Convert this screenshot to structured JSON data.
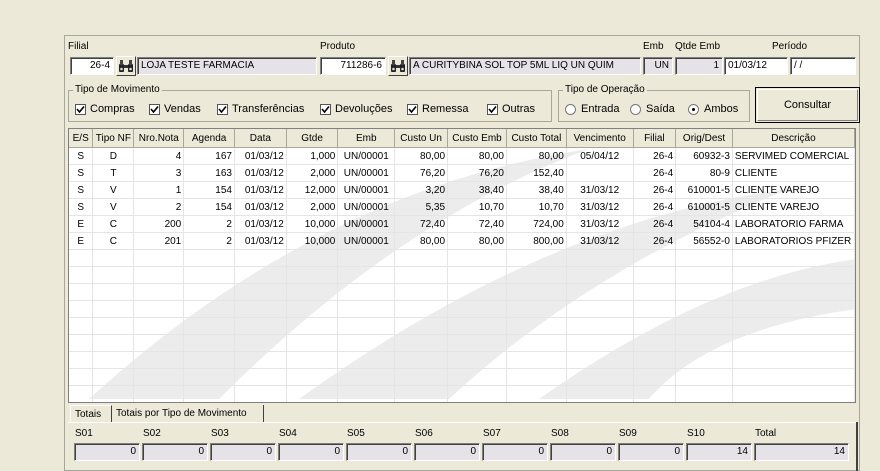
{
  "header": {
    "filial_label": "Filial",
    "filial_code": "26-4",
    "filial_name": "LOJA TESTE FARMACIA",
    "produto_label": "Produto",
    "produto_code": "711286-6",
    "produto_desc": "A CURITYBINA SOL TOP 5ML LIQ UN QUIM",
    "emb_label": "Emb",
    "emb_value": "UN",
    "qtde_emb_label": "Qtde Emb",
    "qtde_emb_value": "1",
    "periodo_label": "Período",
    "periodo_from": "01/03/12",
    "periodo_to": " / /"
  },
  "tipo_movimento": {
    "title": "Tipo de Movimento",
    "items": [
      {
        "label": "Compras",
        "checked": true
      },
      {
        "label": "Vendas",
        "checked": true
      },
      {
        "label": "Transferências",
        "checked": true
      },
      {
        "label": "Devoluções",
        "checked": true
      },
      {
        "label": "Remessa",
        "checked": true
      },
      {
        "label": "Outras",
        "checked": true
      }
    ]
  },
  "tipo_operacao": {
    "title": "Tipo de Operação",
    "items": [
      {
        "label": "Entrada",
        "selected": false
      },
      {
        "label": "Saída",
        "selected": false
      },
      {
        "label": "Ambos",
        "selected": true
      }
    ]
  },
  "consultar_label": "Consultar",
  "grid": {
    "columns": [
      "E/S",
      "Tipo NF",
      "Nro.Nota",
      "Agenda",
      "Data",
      "Gtde",
      "Emb",
      "Custo Un",
      "Custo Emb",
      "Custo Total",
      "Vencimento",
      "Filial",
      "Orig/Dest",
      "Descrição"
    ],
    "rows": [
      [
        "S",
        "D",
        "4",
        "167",
        "01/03/12",
        "1,000",
        "UN/00001",
        "80,00",
        "80,00",
        "80,00",
        "05/04/12",
        "26-4",
        "60932-3",
        "SERVIMED COMERCIAL"
      ],
      [
        "S",
        "T",
        "3",
        "163",
        "01/03/12",
        "2,000",
        "UN/00001",
        "76,20",
        "76,20",
        "152,40",
        "",
        "26-4",
        "80-9",
        "CLIENTE"
      ],
      [
        "S",
        "V",
        "1",
        "154",
        "01/03/12",
        "12,000",
        "UN/00001",
        "3,20",
        "38,40",
        "38,40",
        "31/03/12",
        "26-4",
        "610001-5",
        "CLIENTE VAREJO"
      ],
      [
        "S",
        "V",
        "2",
        "154",
        "01/03/12",
        "2,000",
        "UN/00001",
        "5,35",
        "10,70",
        "10,70",
        "31/03/12",
        "26-4",
        "610001-5",
        "CLIENTE VAREJO"
      ],
      [
        "E",
        "C",
        "200",
        "2",
        "01/03/12",
        "10,000",
        "UN/00001",
        "72,40",
        "72,40",
        "724,00",
        "31/03/12",
        "26-4",
        "54104-4",
        "LABORATORIO FARMA"
      ],
      [
        "E",
        "C",
        "201",
        "2",
        "01/03/12",
        "10,000",
        "UN/00001",
        "80,00",
        "80,00",
        "800,00",
        "31/03/12",
        "26-4",
        "56552-0",
        "LABORATORIOS PFIZER"
      ]
    ]
  },
  "tabs": [
    "Totais",
    "Totais por Tipo de Movimento"
  ],
  "totals": [
    {
      "label": "S01",
      "value": "0"
    },
    {
      "label": "S02",
      "value": "0"
    },
    {
      "label": "S03",
      "value": "0"
    },
    {
      "label": "S04",
      "value": "0"
    },
    {
      "label": "S05",
      "value": "0"
    },
    {
      "label": "S06",
      "value": "0"
    },
    {
      "label": "S07",
      "value": "0"
    },
    {
      "label": "S08",
      "value": "0"
    },
    {
      "label": "S09",
      "value": "0"
    },
    {
      "label": "S10",
      "value": "14"
    },
    {
      "label": "Total",
      "value": "14"
    }
  ]
}
